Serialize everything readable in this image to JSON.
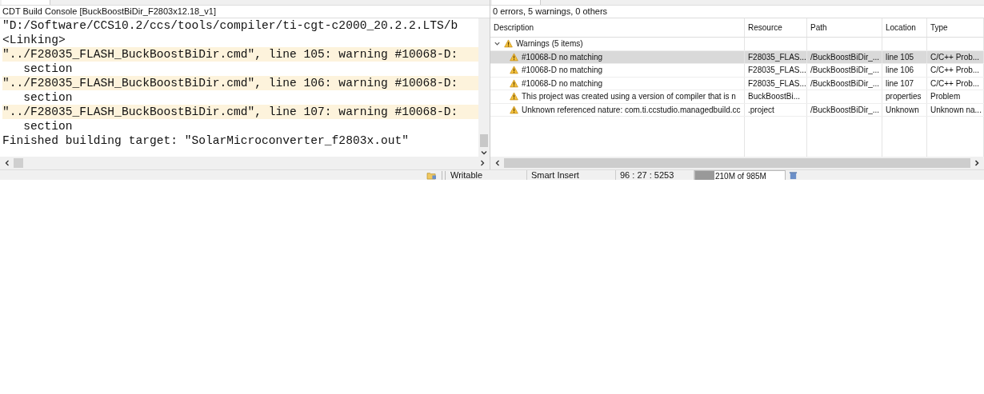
{
  "console": {
    "title": "CDT Build Console [BuckBoostBiDir_F2803x12.18_v1]",
    "lines": [
      {
        "text": "\"D:/Software/CCS10.2/ccs/tools/compiler/ti-cgt-c2000_20.2.2.LTS/b",
        "kind": "normal"
      },
      {
        "text": "<Linking>",
        "kind": "normal"
      },
      {
        "text": "\"../F28035_FLASH_BuckBoostBiDir.cmd\", line 105: warning #10068-D:",
        "kind": "warning"
      },
      {
        "text": "   section",
        "kind": "normal"
      },
      {
        "text": "\"../F28035_FLASH_BuckBoostBiDir.cmd\", line 106: warning #10068-D:",
        "kind": "warning"
      },
      {
        "text": "   section",
        "kind": "normal"
      },
      {
        "text": "\"../F28035_FLASH_BuckBoostBiDir.cmd\", line 107: warning #10068-D:",
        "kind": "warning"
      },
      {
        "text": "   section",
        "kind": "normal"
      },
      {
        "text": "Finished building target: \"SolarMicroconverter_f2803x.out\"",
        "kind": "normal"
      }
    ]
  },
  "problems": {
    "summary": "0 errors, 5 warnings, 0 others",
    "columns": [
      "Description",
      "Resource",
      "Path",
      "Location",
      "Type"
    ],
    "groups": [
      {
        "label": "Warnings (5 items)",
        "expanded": true,
        "children": [
          {
            "cells": [
              "#10068-D no matching",
              "F28035_FLAS...",
              "/BuckBoostBiDir_...",
              "line 105",
              "C/C++ Prob..."
            ],
            "selected": true
          },
          {
            "cells": [
              "#10068-D no matching",
              "F28035_FLAS...",
              "/BuckBoostBiDir_...",
              "line 106",
              "C/C++ Prob..."
            ],
            "selected": false
          },
          {
            "cells": [
              "#10068-D no matching",
              "F28035_FLAS...",
              "/BuckBoostBiDir_...",
              "line 107",
              "C/C++ Prob..."
            ],
            "selected": false
          },
          {
            "cells": [
              "This project was created using a version of compiler that is n",
              "BuckBoostBi...",
              "",
              "properties",
              "Problem"
            ],
            "selected": false
          },
          {
            "cells": [
              "Unknown referenced nature: com.ti.ccstudio.managedbuild.cc",
              ".project",
              "/BuckBoostBiDir_...",
              "Unknown",
              "Unknown na..."
            ],
            "selected": false
          }
        ]
      }
    ]
  },
  "status_bar": {
    "mode": "Writable",
    "insert": "Smart Insert",
    "position": "96 : 27 : 5253",
    "memory": {
      "text": "210M of 985M",
      "level": 0.21
    }
  }
}
